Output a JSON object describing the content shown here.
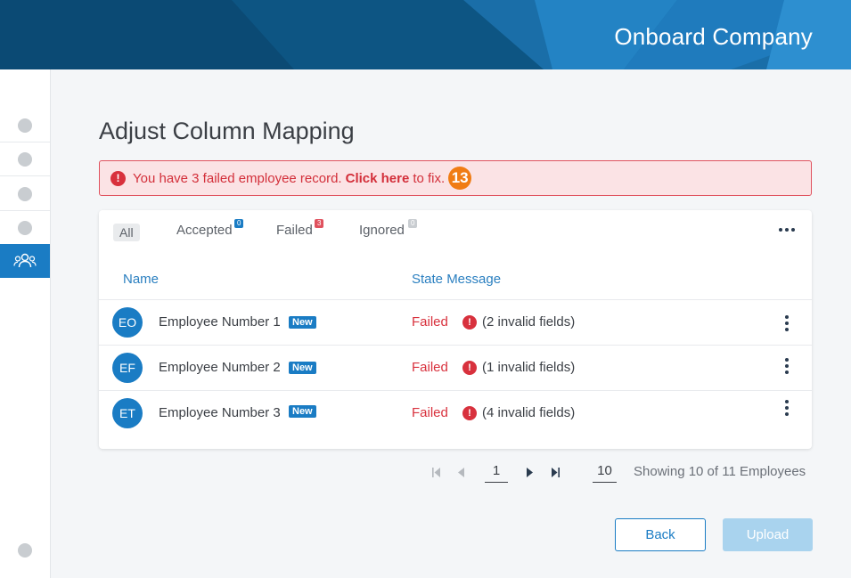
{
  "header": {
    "title": "Onboard Company"
  },
  "sidebar": {
    "steps": [
      {
        "id": "step-1"
      },
      {
        "id": "step-2"
      },
      {
        "id": "step-3"
      },
      {
        "id": "step-4"
      },
      {
        "id": "step-employees",
        "icon": "users-icon",
        "active": true
      }
    ]
  },
  "page": {
    "title": "Adjust Column Mapping"
  },
  "alert": {
    "text_before": "You have 3 failed employee record.",
    "link": "Click here",
    "text_after": "to fix.",
    "badge": "13"
  },
  "tabs": [
    {
      "label": "All",
      "count": null
    },
    {
      "label": "Accepted",
      "count": "0",
      "color": "#1a7cc4"
    },
    {
      "label": "Failed",
      "count": "3",
      "color": "#e0525e"
    },
    {
      "label": "Ignored",
      "count": "0",
      "color": "#c9cdd1"
    }
  ],
  "table": {
    "columns": [
      "Name",
      "State Message"
    ],
    "rows": [
      {
        "initials": "EO",
        "name": "Employee Number 1",
        "badge": "New",
        "status": "Failed",
        "message": "(2 invalid fields)"
      },
      {
        "initials": "EF",
        "name": "Employee Number 2",
        "badge": "New",
        "status": "Failed",
        "message": "(1 invalid fields)"
      },
      {
        "initials": "ET",
        "name": "Employee Number 3",
        "badge": "New",
        "status": "Failed",
        "message": "(4 invalid fields)"
      }
    ]
  },
  "pagination": {
    "page": "1",
    "page_size": "10",
    "showing": "Showing 10 of 11 Employees"
  },
  "buttons": {
    "back": "Back",
    "upload": "Upload"
  },
  "colors": {
    "accent": "#1a7cc4",
    "error": "#d8313d",
    "header": "#0b4a74",
    "badge_orange": "#f07c13"
  }
}
